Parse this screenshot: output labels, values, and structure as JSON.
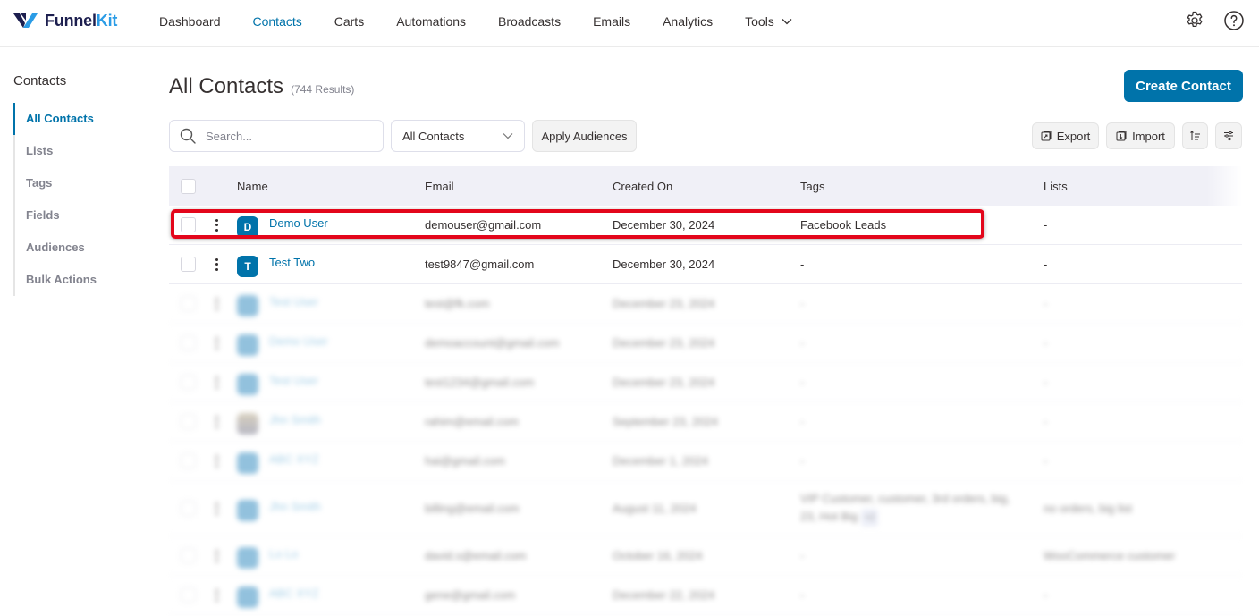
{
  "brand": {
    "name_part1": "Funnel",
    "name_part2": "Kit",
    "accent": "#0073aa"
  },
  "nav": {
    "items": [
      {
        "label": "Dashboard",
        "active": false
      },
      {
        "label": "Contacts",
        "active": true
      },
      {
        "label": "Carts",
        "active": false
      },
      {
        "label": "Automations",
        "active": false
      },
      {
        "label": "Broadcasts",
        "active": false
      },
      {
        "label": "Emails",
        "active": false
      },
      {
        "label": "Analytics",
        "active": false
      },
      {
        "label": "Tools",
        "active": false,
        "has_dropdown": true
      }
    ],
    "icons": [
      "gear-icon",
      "help-icon"
    ]
  },
  "sidebar": {
    "title": "Contacts",
    "items": [
      {
        "label": "All Contacts",
        "active": true
      },
      {
        "label": "Lists"
      },
      {
        "label": "Tags"
      },
      {
        "label": "Fields"
      },
      {
        "label": "Audiences"
      },
      {
        "label": "Bulk Actions"
      }
    ]
  },
  "page": {
    "title": "All Contacts",
    "result_count": "(744 Results)",
    "create_button": "Create Contact"
  },
  "filters": {
    "search_placeholder": "Search...",
    "search_value": "",
    "audience_select": "All Contacts",
    "apply_button": "Apply Audiences",
    "export_button": "Export",
    "import_button": "Import"
  },
  "table": {
    "columns": [
      "Name",
      "Email",
      "Created On",
      "Tags",
      "Lists"
    ],
    "rows": [
      {
        "initial": "D",
        "name": "Demo User",
        "email": "demouser@gmail.com",
        "created": "December 30, 2024",
        "tags": "Facebook Leads",
        "lists": "-",
        "highlighted": true
      },
      {
        "initial": "T",
        "name": "Test Two",
        "email": "test9847@gmail.com",
        "created": "December 30, 2024",
        "tags": "-",
        "lists": "-"
      }
    ],
    "blurred_rows": [
      {
        "name": "Test User",
        "email": "test@fk.com",
        "created": "December 23, 2024",
        "tags": "-",
        "lists": "-"
      },
      {
        "name": "Demo User",
        "email": "demoaccount@gmail.com",
        "created": "December 23, 2024",
        "tags": "-",
        "lists": "-"
      },
      {
        "name": "Test User",
        "email": "test1234@gmail.com",
        "created": "December 23, 2024",
        "tags": "-",
        "lists": "-"
      },
      {
        "name": "Jhn Smith",
        "email": "rahim@email.com",
        "created": "September 23, 2024",
        "tags": "-",
        "lists": "-",
        "image_avatar": true
      },
      {
        "name": "ABC XYZ",
        "email": "hai@gmail.com",
        "created": "December 1, 2024",
        "tags": "-",
        "lists": "-"
      },
      {
        "name": "Jhn Smith",
        "email": "billing@email.com",
        "created": "August 11, 2024",
        "tags": "VIP Customer, customer, 3rd orders, big, 23, Hot Big",
        "tag_more": "+2",
        "lists": "no orders, big list"
      },
      {
        "name": "Lo Lo",
        "email": "david.s@email.com",
        "created": "October 16, 2024",
        "tags": "-",
        "lists": "WooCommerce customer"
      },
      {
        "name": "ABC XYZ",
        "email": "gene@gmail.com",
        "created": "December 22, 2024",
        "tags": "-",
        "lists": "-"
      }
    ]
  }
}
